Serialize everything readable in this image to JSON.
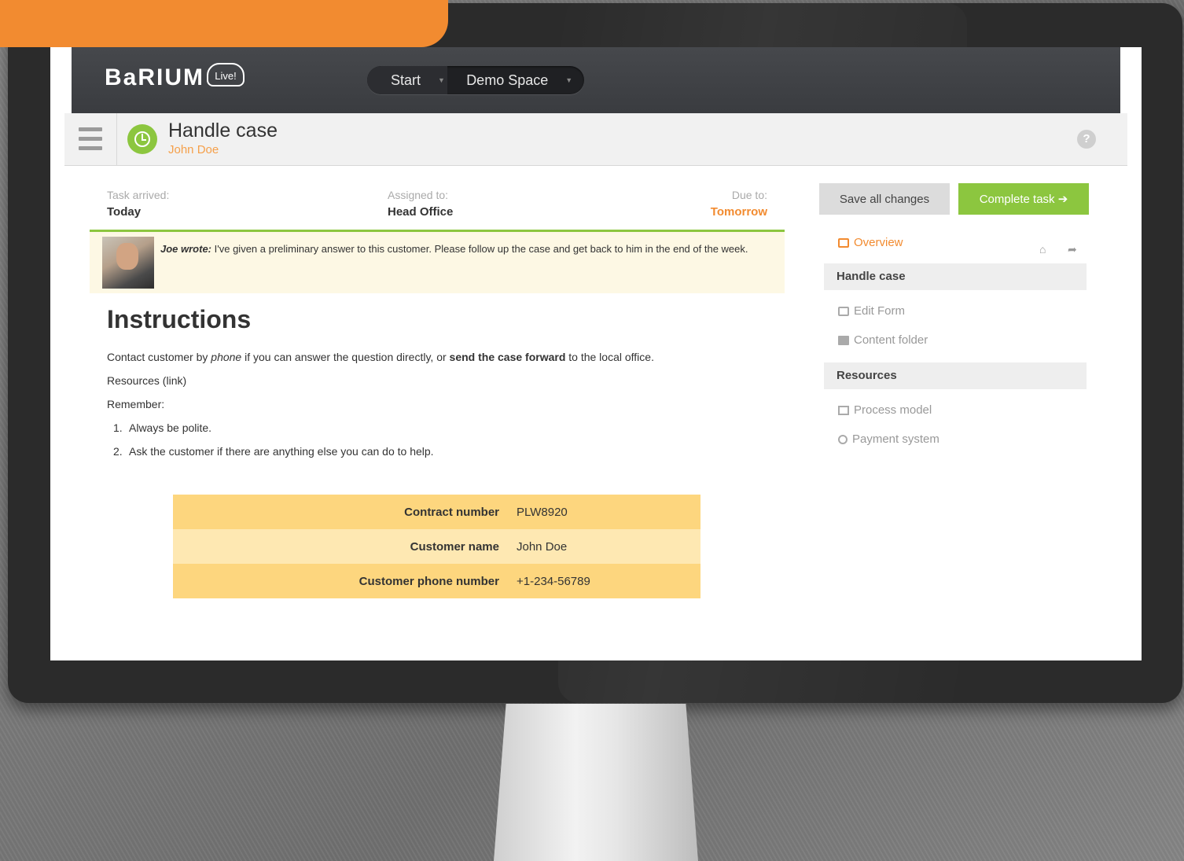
{
  "app": {
    "logo": "BaRIUM",
    "logo_badge": "Live!",
    "nav": {
      "start": "Start",
      "space": "Demo Space"
    }
  },
  "header": {
    "title": "Handle case",
    "subtitle": "John Doe",
    "help": "?"
  },
  "meta": {
    "arrived_label": "Task arrived:",
    "arrived_value": "Today",
    "assigned_label": "Assigned to:",
    "assigned_value": "Head Office",
    "due_label": "Due to:",
    "due_value": "Tomorrow"
  },
  "comment": {
    "author": "Joe wrote:",
    "text": "I've given a preliminary answer to this customer. Please follow up the case and get back to him in the end of the week."
  },
  "instructions": {
    "title": "Instructions",
    "line1_pre": "Contact customer by ",
    "line1_em": "phone",
    "line1_mid": " if you can answer the question directly, or ",
    "line1_strong": "send the case forward",
    "line1_post": " to the local office.",
    "resources_link": "Resources (link)",
    "remember": "Remember:",
    "items": [
      "Always be polite.",
      "Ask the customer if there are anything else you can do to help."
    ]
  },
  "info_table": [
    {
      "label": "Contract number",
      "value": "PLW8920"
    },
    {
      "label": "Customer name",
      "value": "John Doe"
    },
    {
      "label": "Customer phone number",
      "value": "+1-234-56789"
    }
  ],
  "side": {
    "save_label": "Save all changes",
    "complete_label": "Complete task ➔",
    "overview": "Overview",
    "section1": "Handle case",
    "edit_form": "Edit Form",
    "content_folder": "Content folder",
    "section2": "Resources",
    "process_model": "Process model",
    "payment_system": "Payment system"
  },
  "colors": {
    "accent_green": "#8cc63f",
    "accent_orange": "#f28b30",
    "table_dark": "#fdd67e",
    "table_light": "#fee8b2"
  }
}
